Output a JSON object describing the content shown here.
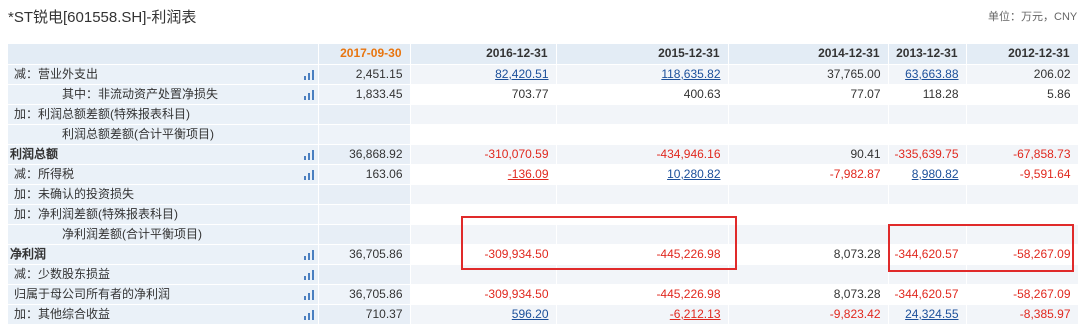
{
  "title": "*ST锐电[601558.SH]-利润表",
  "unit_label": "单位：万元，CNY",
  "columns": [
    "2017-09-30",
    "2016-12-31",
    "2015-12-31",
    "2014-12-31",
    "2013-12-31",
    "2012-12-31"
  ],
  "rows": [
    {
      "label": "减：营业外支出",
      "bold": false,
      "chart": true,
      "values": [
        {
          "text": "2,451.15",
          "neg": false,
          "link": false
        },
        {
          "text": "82,420.51",
          "neg": false,
          "link": true
        },
        {
          "text": "118,635.82",
          "neg": false,
          "link": true
        },
        {
          "text": "37,765.00",
          "neg": false,
          "link": false
        },
        {
          "text": "63,663.88",
          "neg": false,
          "link": true
        },
        {
          "text": "206.02",
          "neg": false,
          "link": false
        }
      ]
    },
    {
      "label": "其中：非流动资产处置净损失",
      "bold": false,
      "chart": true,
      "indent": true,
      "values": [
        {
          "text": "1,833.45",
          "neg": false,
          "link": false
        },
        {
          "text": "703.77",
          "neg": false,
          "link": false
        },
        {
          "text": "400.63",
          "neg": false,
          "link": false
        },
        {
          "text": "77.07",
          "neg": false,
          "link": false
        },
        {
          "text": "118.28",
          "neg": false,
          "link": false
        },
        {
          "text": "5.86",
          "neg": false,
          "link": false
        }
      ]
    },
    {
      "label": "加：利润总额差额(特殊报表科目)",
      "bold": false,
      "chart": false,
      "values": [
        {
          "text": ""
        },
        {
          "text": ""
        },
        {
          "text": ""
        },
        {
          "text": ""
        },
        {
          "text": ""
        },
        {
          "text": ""
        }
      ]
    },
    {
      "label": "利润总额差额(合计平衡项目)",
      "bold": false,
      "chart": false,
      "indent": true,
      "values": [
        {
          "text": ""
        },
        {
          "text": ""
        },
        {
          "text": ""
        },
        {
          "text": ""
        },
        {
          "text": ""
        },
        {
          "text": ""
        }
      ]
    },
    {
      "label": "利润总额",
      "bold": true,
      "chart": true,
      "values": [
        {
          "text": "36,868.92",
          "neg": false,
          "link": false
        },
        {
          "text": "-310,070.59",
          "neg": true,
          "link": false
        },
        {
          "text": "-434,946.16",
          "neg": true,
          "link": false
        },
        {
          "text": "90.41",
          "neg": false,
          "link": false
        },
        {
          "text": "-335,639.75",
          "neg": true,
          "link": false
        },
        {
          "text": "-67,858.73",
          "neg": true,
          "link": false
        }
      ]
    },
    {
      "label": "减：所得税",
      "bold": false,
      "chart": true,
      "values": [
        {
          "text": "163.06",
          "neg": false,
          "link": false
        },
        {
          "text": "-136.09",
          "neg": true,
          "link": true
        },
        {
          "text": "10,280.82",
          "neg": false,
          "link": true
        },
        {
          "text": "-7,982.87",
          "neg": true,
          "link": false
        },
        {
          "text": "8,980.82",
          "neg": false,
          "link": true
        },
        {
          "text": "-9,591.64",
          "neg": true,
          "link": false
        }
      ]
    },
    {
      "label": "加：未确认的投资损失",
      "bold": false,
      "chart": false,
      "values": [
        {
          "text": ""
        },
        {
          "text": ""
        },
        {
          "text": ""
        },
        {
          "text": ""
        },
        {
          "text": ""
        },
        {
          "text": ""
        }
      ]
    },
    {
      "label": "加：净利润差额(特殊报表科目)",
      "bold": false,
      "chart": false,
      "values": [
        {
          "text": ""
        },
        {
          "text": ""
        },
        {
          "text": ""
        },
        {
          "text": ""
        },
        {
          "text": ""
        },
        {
          "text": ""
        }
      ]
    },
    {
      "label": "净利润差额(合计平衡项目)",
      "bold": false,
      "chart": false,
      "indent": true,
      "values": [
        {
          "text": ""
        },
        {
          "text": ""
        },
        {
          "text": ""
        },
        {
          "text": ""
        },
        {
          "text": ""
        },
        {
          "text": ""
        }
      ]
    },
    {
      "label": "净利润",
      "bold": true,
      "chart": true,
      "values": [
        {
          "text": "36,705.86",
          "neg": false,
          "link": false
        },
        {
          "text": "-309,934.50",
          "neg": true,
          "link": false
        },
        {
          "text": "-445,226.98",
          "neg": true,
          "link": false
        },
        {
          "text": "8,073.28",
          "neg": false,
          "link": false
        },
        {
          "text": "-344,620.57",
          "neg": true,
          "link": false
        },
        {
          "text": "-58,267.09",
          "neg": true,
          "link": false
        }
      ]
    },
    {
      "label": "减：少数股东损益",
      "bold": false,
      "chart": true,
      "values": [
        {
          "text": ""
        },
        {
          "text": ""
        },
        {
          "text": ""
        },
        {
          "text": ""
        },
        {
          "text": ""
        },
        {
          "text": ""
        }
      ]
    },
    {
      "label": "归属于母公司所有者的净利润",
      "bold": false,
      "chart": true,
      "values": [
        {
          "text": "36,705.86",
          "neg": false,
          "link": false
        },
        {
          "text": "-309,934.50",
          "neg": true,
          "link": false
        },
        {
          "text": "-445,226.98",
          "neg": true,
          "link": false
        },
        {
          "text": "8,073.28",
          "neg": false,
          "link": false
        },
        {
          "text": "-344,620.57",
          "neg": true,
          "link": false
        },
        {
          "text": "-58,267.09",
          "neg": true,
          "link": false
        }
      ]
    },
    {
      "label": "加：其他综合收益",
      "bold": false,
      "chart": true,
      "values": [
        {
          "text": "710.37",
          "neg": false,
          "link": false
        },
        {
          "text": "596.20",
          "neg": false,
          "link": true
        },
        {
          "text": "-6,212.13",
          "neg": true,
          "link": true
        },
        {
          "text": "-9,823.42",
          "neg": true,
          "link": false
        },
        {
          "text": "24,324.55",
          "neg": false,
          "link": true
        },
        {
          "text": "-8,385.97",
          "neg": true,
          "link": false
        }
      ]
    }
  ],
  "colors": {
    "negative": "#e0281e",
    "link": "#1b4f9a",
    "current_period": "#e8750f",
    "highlight_box": "#e02a2a"
  },
  "icons": {
    "row_chart": "bar-chart-icon"
  }
}
